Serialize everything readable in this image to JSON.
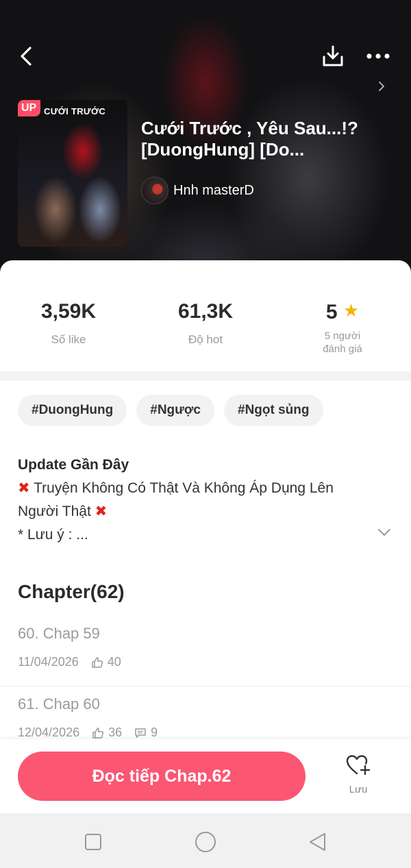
{
  "header": {
    "icons": {
      "back": "chevron-left-icon",
      "download": "download-icon",
      "more": "more-dots-icon"
    }
  },
  "book": {
    "cover_tag": "UP",
    "cover_title": "CƯỚI TRƯỚC",
    "title": "Cưới Trước , Yêu Sau...!? [DuongHung] [Do...",
    "author": "Hnh masterD"
  },
  "stats": {
    "likes_value": "3,59K",
    "likes_label": "Số like",
    "hot_value": "61,3K",
    "hot_label": "Độ hot",
    "rating_value": "5",
    "rating_label_1": "5 người",
    "rating_label_2": "đánh giá"
  },
  "tags": [
    "#DuongHung",
    "#Ngược",
    "#Ngọt sủng"
  ],
  "update": {
    "title": "Update Gần Đây",
    "line1": "Truyện Không Có Thật Và Không Áp Dụng Lên",
    "line2": "Người Thật",
    "line3": "* Lưu ý : ..."
  },
  "chapters": {
    "title": "Chapter(62)",
    "items": [
      {
        "title": "60. Chap 59",
        "date": "11/04/2026",
        "likes": "40",
        "comments": ""
      },
      {
        "title": "61. Chap 60",
        "date": "12/04/2026",
        "likes": "36",
        "comments": "9"
      }
    ]
  },
  "actions": {
    "read_label": "Đọc tiếp Chap.62",
    "save_label": "Lưu"
  },
  "colors": {
    "accent": "#fb5672",
    "star": "#f6b400",
    "cross": "#e0241b"
  }
}
